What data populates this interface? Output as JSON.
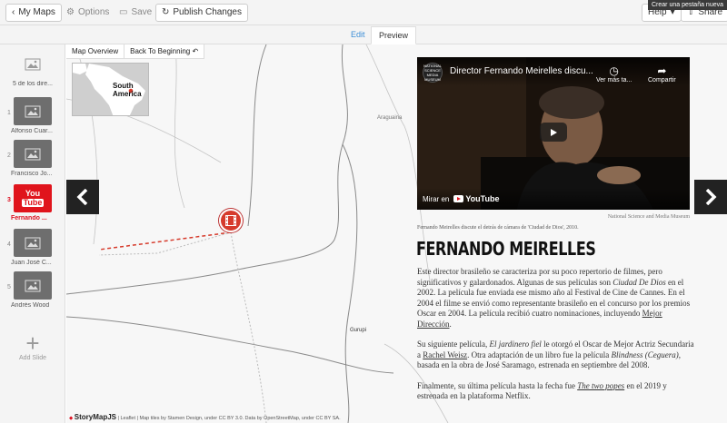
{
  "toolbar": {
    "my_maps": "My Maps",
    "options": "Options",
    "save": "Save",
    "publish": "Publish Changes",
    "help": "Help",
    "share": "Share",
    "tooltip": "Crear una pestaña nueva"
  },
  "tabs": {
    "edit": "Edit",
    "preview": "Preview"
  },
  "slides": [
    {
      "number": "",
      "label": "5 de los dire..."
    },
    {
      "number": "1",
      "label": "Alfonso Cuar..."
    },
    {
      "number": "2",
      "label": "Francisco Jo..."
    },
    {
      "number": "3",
      "label": "Fernando ...",
      "logo_top": "You",
      "logo_bottom": "Tube"
    },
    {
      "number": "4",
      "label": "Juan José C..."
    },
    {
      "number": "5",
      "label": "Andrés Wood"
    }
  ],
  "add_slide": "Add Slide",
  "map": {
    "overview_button": "Map Overview",
    "back_button": "Back To Beginning",
    "overview_label_1": "South",
    "overview_label_2": "America",
    "cities": [
      "Araguaina",
      "Gurupi"
    ],
    "credits_brand": "StoryMapJS",
    "credits_text": "| Leaflet | Map tiles by Stamen Design, under CC BY 3.0. Data by OpenStreetMap, under CC BY SA."
  },
  "video": {
    "title": "Director Fernando Meirelles discu...",
    "channel_label": "NATIONAL SCIENCE MEDIA MUSEUM",
    "watch_later": "Ver más ta...",
    "share": "Compartir",
    "watch_on": "Mirar en",
    "youtube": "YouTube"
  },
  "story": {
    "credit": "National Science and Media Museum",
    "caption": "Fernando Meirelles discute el detrás de cámara de 'Ciudad de Dios', 2010.",
    "headline": "FERNANDO MEIRELLES",
    "p1_a": "Este director brasileño se caracteriza por su poco repertorio de filmes, pero significativos y galardonados. Algunas de sus películas son ",
    "p1_film1": "Ciudad De Dios",
    "p1_b": " en el 2002. La película fue enviada ese mismo año al Festival de Cine de Cannes. En el 2004 el filme se envió como representante brasileño en el concurso por los premios Oscar en 2004. La película recibió cuatro nominaciones, incluyendo ",
    "p1_link": "Mejor Dirección",
    "p1_c": ".",
    "p2_a": "Su siguiente película, ",
    "p2_film": "El jardinero fiel",
    "p2_b": " le otorgó el Oscar de Mejor Actriz Secundaria a ",
    "p2_link": "Rachel Weisz",
    "p2_c": ". Otra adaptación de un libro fue la película ",
    "p2_film2": "Blindness (Ceguera)",
    "p2_d": ", basada en la obra de José Saramago, estrenada en septiembre del 2008.",
    "p3_a": "Finalmente, su última película hasta la fecha fue ",
    "p3_film": "The two popes",
    "p3_b": " en el 2019 y estrenada en la plataforma Netflix."
  }
}
